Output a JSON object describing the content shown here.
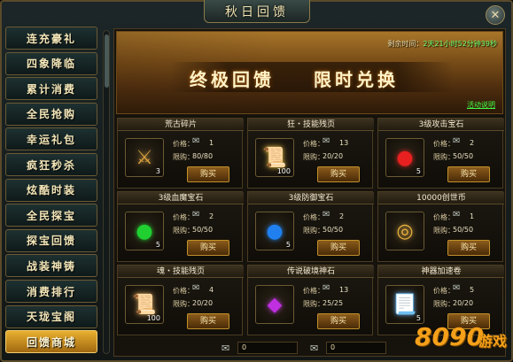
{
  "window": {
    "title": "秋日回馈"
  },
  "sidebar": {
    "items": [
      {
        "label": "连充豪礼"
      },
      {
        "label": "四象降临"
      },
      {
        "label": "累计消费"
      },
      {
        "label": "全民抢购"
      },
      {
        "label": "幸运礼包"
      },
      {
        "label": "疯狂秒杀"
      },
      {
        "label": "炫酷时装"
      },
      {
        "label": "全民探宝"
      },
      {
        "label": "探宝回馈"
      },
      {
        "label": "战装神铸"
      },
      {
        "label": "消费排行"
      },
      {
        "label": "天珑宝阁"
      },
      {
        "label": "回馈商城",
        "active": true
      }
    ]
  },
  "banner": {
    "title_left": "终极回馈",
    "title_right": "限时兑换",
    "time_label": "剩余时间：",
    "time_value": "2天21小时52分钟39秒",
    "rules_link": "活动说明"
  },
  "labels": {
    "price": "价格：",
    "limit": "限购：",
    "buy": "购买"
  },
  "items": [
    {
      "name": "荒古碎片",
      "icon": "ancient-shard-icon",
      "glyph": "⚔",
      "count": "3",
      "price": "1",
      "limit": "80/80",
      "color": "#d8a040"
    },
    {
      "name": "狂・技能残页",
      "icon": "skill-page-icon",
      "glyph": "📜",
      "count": "100",
      "price": "13",
      "limit": "20/20",
      "color": "#e8c040"
    },
    {
      "name": "3级攻击宝石",
      "icon": "red-gem-icon",
      "glyph": "●",
      "count": "5",
      "price": "2",
      "limit": "50/50",
      "color": "#e82020"
    },
    {
      "name": "3级血魔宝石",
      "icon": "green-gem-icon",
      "glyph": "●",
      "count": "5",
      "price": "2",
      "limit": "50/50",
      "color": "#20d030"
    },
    {
      "name": "3级防御宝石",
      "icon": "blue-gem-icon",
      "glyph": "●",
      "count": "5",
      "price": "2",
      "limit": "50/50",
      "color": "#2080f0"
    },
    {
      "name": "10000创世币",
      "icon": "coin-icon",
      "glyph": "◎",
      "count": "",
      "price": "1",
      "limit": "50/50",
      "color": "#e8b040"
    },
    {
      "name": "魂・技能残页",
      "icon": "soul-page-icon",
      "glyph": "📜",
      "count": "100",
      "price": "4",
      "limit": "20/20",
      "color": "#d8a860"
    },
    {
      "name": "传说破境神石",
      "icon": "purple-stone-icon",
      "glyph": "◆",
      "count": "",
      "price": "13",
      "limit": "25/25",
      "color": "#c030e0"
    },
    {
      "name": "神器加速卷",
      "icon": "scroll-icon",
      "glyph": "📃",
      "count": "5",
      "price": "5",
      "limit": "20/20",
      "color": "#60a0e0"
    }
  ],
  "bottom": {
    "ticket_a": "0",
    "ticket_b": "0"
  },
  "watermark": {
    "num": "8090",
    "txt": "游戏"
  }
}
